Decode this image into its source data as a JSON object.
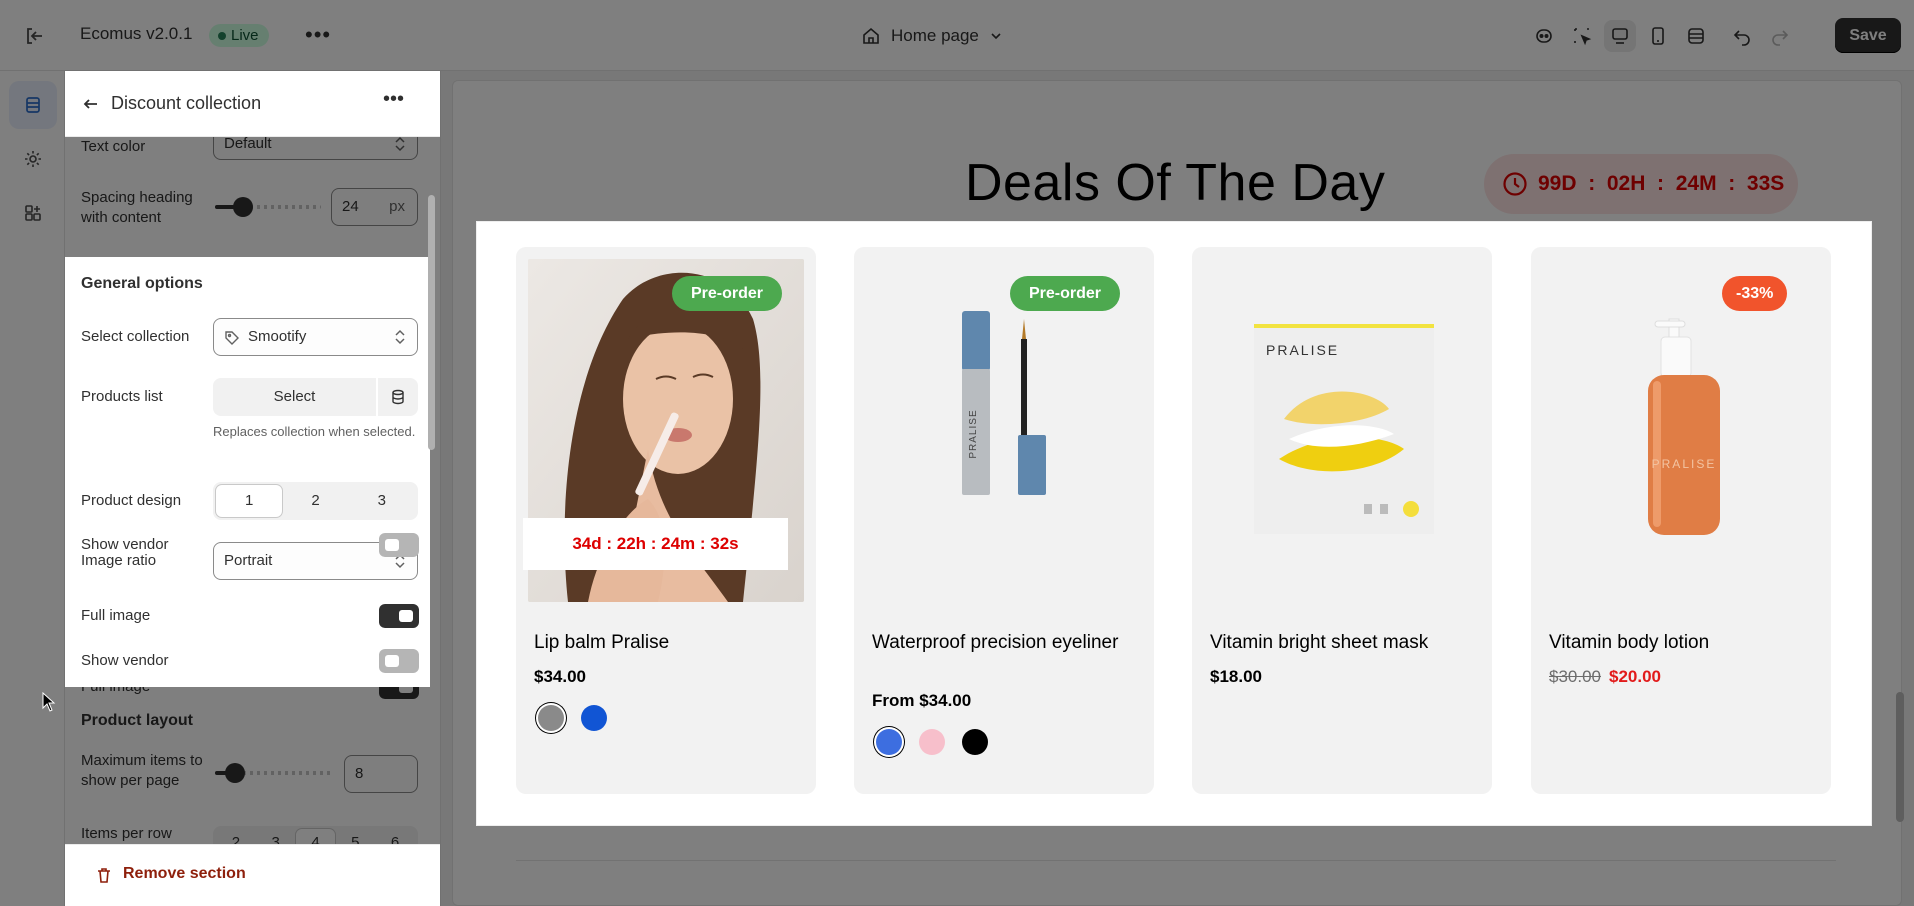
{
  "topbar": {
    "app_title": "Ecomus v2.0.1",
    "status": "Live",
    "more": "•••",
    "page_selector": "Home page",
    "save": "Save"
  },
  "panel": {
    "title": "Discount collection",
    "more": "•••",
    "text_color": {
      "label": "Text color",
      "value": "Default"
    },
    "spacing": {
      "label": "Spacing heading with content",
      "value": "24",
      "unit": "px"
    },
    "general": {
      "title": "General options",
      "collection": {
        "label": "Select collection",
        "value": "Smootify"
      },
      "products_list": {
        "label": "Products list",
        "button": "Select",
        "helper": "Replaces collection when selected."
      },
      "product_design": {
        "label": "Product design",
        "options": [
          "1",
          "2",
          "3"
        ],
        "selected": "1"
      },
      "image_ratio": {
        "label": "Image ratio",
        "value": "Portrait"
      },
      "full_image": {
        "label": "Full image",
        "on": true
      },
      "show_vendor": {
        "label": "Show vendor",
        "on": false
      }
    },
    "layout": {
      "title": "Product layout",
      "max_items": {
        "label": "Maximum items to show per page",
        "value": "8"
      },
      "items_per_row": {
        "label": "Items per row (Desktop)",
        "options": [
          "2",
          "3",
          "4",
          "5",
          "6"
        ],
        "selected": "4"
      }
    },
    "remove": "Remove section"
  },
  "preview": {
    "heading": "Deals Of The Day",
    "countdown": "99D  :  02H  :  24M  :  33S",
    "products": [
      {
        "name": "Lip balm Pralise",
        "price": "$34.00",
        "badge": "Pre-order",
        "timer": "34d : 22h : 24m : 32s",
        "swatches": [
          "#8a8a8a",
          "#1155d4"
        ]
      },
      {
        "name": "Waterproof precision eyeliner",
        "price": "From $34.00",
        "badge": "Pre-order",
        "swatches": [
          "#3d6ee0",
          "#f7bfcb",
          "#000000"
        ]
      },
      {
        "name": "Vitamin bright sheet mask",
        "price": "$18.00",
        "brand": "PRALISE"
      },
      {
        "name": "Vitamin body lotion",
        "old_price": "$30.00",
        "price": "$20.00",
        "badge": "-33%",
        "brand": "PRALISE"
      }
    ],
    "eyeliner_brand": "PRALISE"
  },
  "colors": {
    "accent": "#303030",
    "badge_green": "#4da94f",
    "badge_red": "#f1542c",
    "sale_red": "#e21b1b"
  }
}
